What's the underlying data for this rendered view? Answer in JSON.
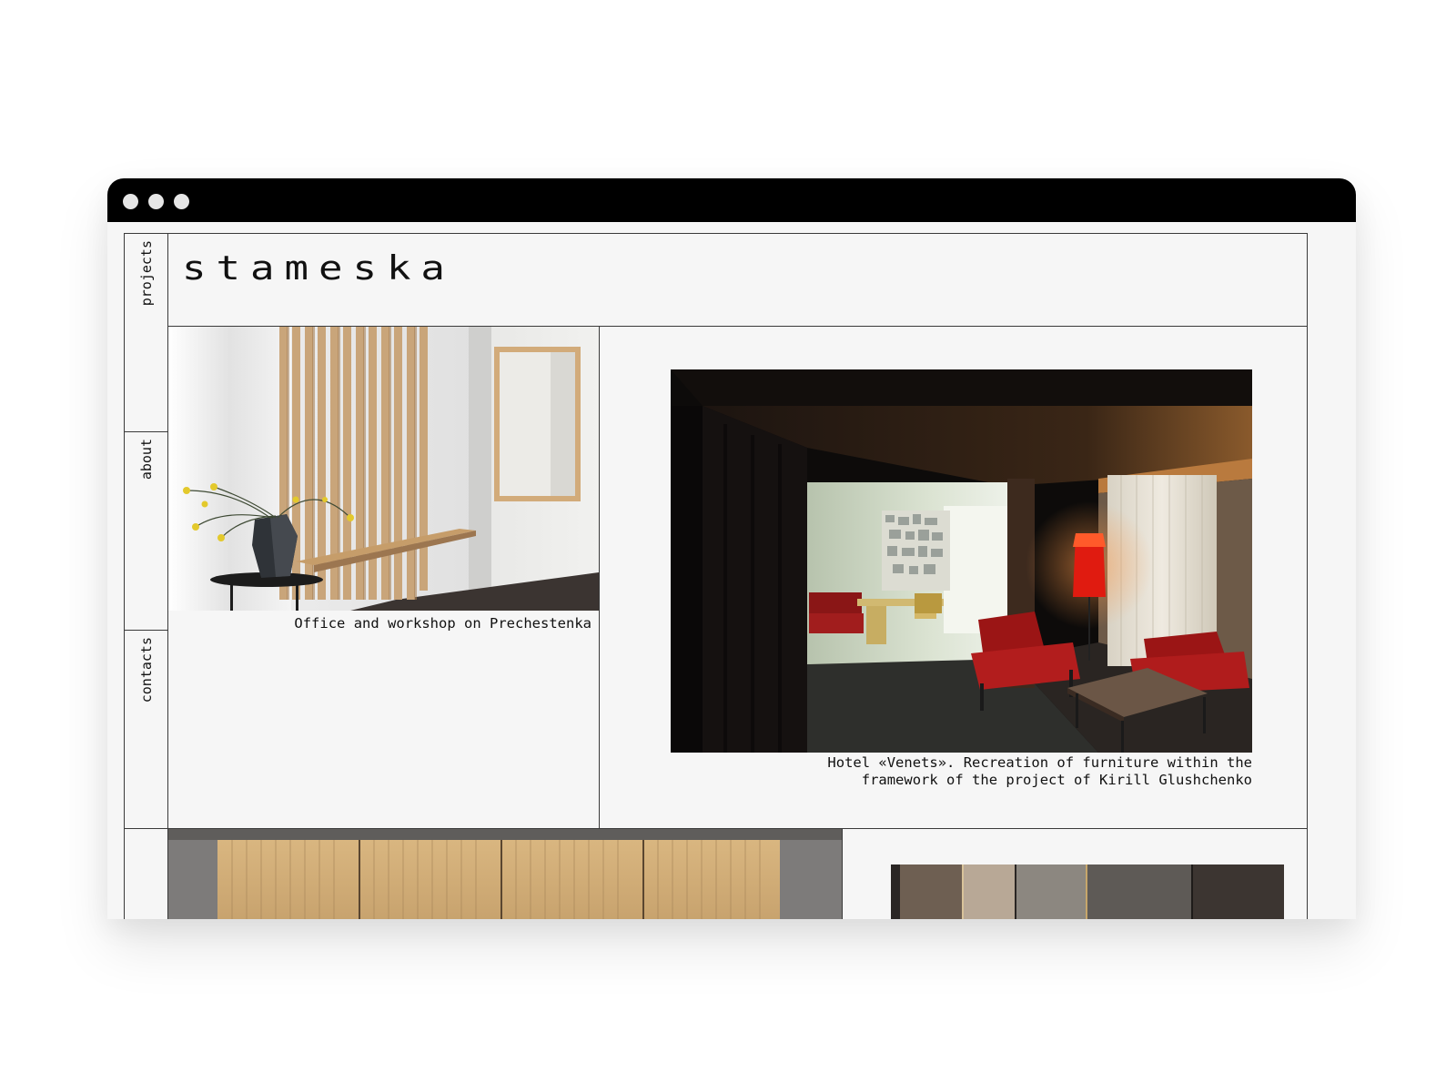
{
  "window": {
    "controls": [
      "close-dot",
      "minimize-dot",
      "maximize-dot"
    ]
  },
  "site": {
    "logo": "stameska"
  },
  "sidebar": {
    "items": [
      {
        "label": "projects"
      },
      {
        "label": "about"
      },
      {
        "label": "contacts"
      }
    ]
  },
  "projects": [
    {
      "caption": "Office and workshop on Prechestenka"
    },
    {
      "caption": "Hotel «Venets». Recreation of furniture within the\nframework of the project of Kirill Glushchenko"
    }
  ],
  "colors": {
    "titlebar": "#000000",
    "page_background": "#f6f6f6",
    "grid_line": "#3a3a3a",
    "text": "#111111"
  }
}
